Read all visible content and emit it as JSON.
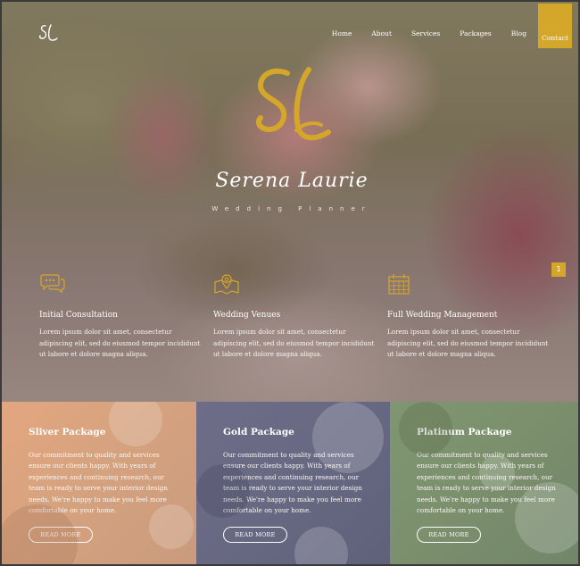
{
  "nav": {
    "logo_text": "SL",
    "items": [
      "Home",
      "About",
      "Services",
      "Packages",
      "Blog"
    ],
    "contact_label": "Contact"
  },
  "hero": {
    "monogram": "SL",
    "name": "Serena Laurie",
    "subtitle": "Wedding Planner",
    "badge": "1"
  },
  "features": [
    {
      "icon": "chat-bubbles-icon",
      "title": "Initial Consultation",
      "text": "Lorem ipsum dolor sit amet, consectetur adipiscing elit, sed do eiusmod tempor incididunt ut labore et dolore magna aliqua."
    },
    {
      "icon": "map-pin-icon",
      "title": "Wedding Venues",
      "text": "Lorem ipsum dolor sit amet, consectetur adipiscing elit, sed do eiusmod tempor incididunt ut labore et dolore magna aliqua."
    },
    {
      "icon": "calendar-icon",
      "title": "Full Wedding Management",
      "text": "Lorem ipsum dolor sit amet, consectetur adipiscing elit, sed do eiusmod tempor incididunt ut labore et dolore magna aliqua."
    }
  ],
  "packages": [
    {
      "title": "Sliver Package",
      "text": "Our commitment to quality and services ensure our clients happy. With years of experiences and continuing research, our team is ready to serve your interior design needs. We're happy to make you feel more comfortable on your home.",
      "button": "READ MORE"
    },
    {
      "title": "Gold Package",
      "text": "Our commitment to quality and services ensure our clients happy. With years of experiences and continuing research, our team is ready to serve your interior design needs. We're happy to make you feel more comfortable on your home.",
      "button": "READ MORE"
    },
    {
      "title": "Platinum Package",
      "text": "Our commitment to quality and services ensure our clients happy. With years of experiences and continuing research, our team is ready to serve your interior design needs. We're happy to make you feel more comfortable on your home.",
      "button": "READ MORE"
    }
  ],
  "colors": {
    "accent": "#d4a62a",
    "silver_panel": "#d9a37f",
    "gold_panel": "#68688a",
    "platinum_panel": "#7b8f6d"
  }
}
